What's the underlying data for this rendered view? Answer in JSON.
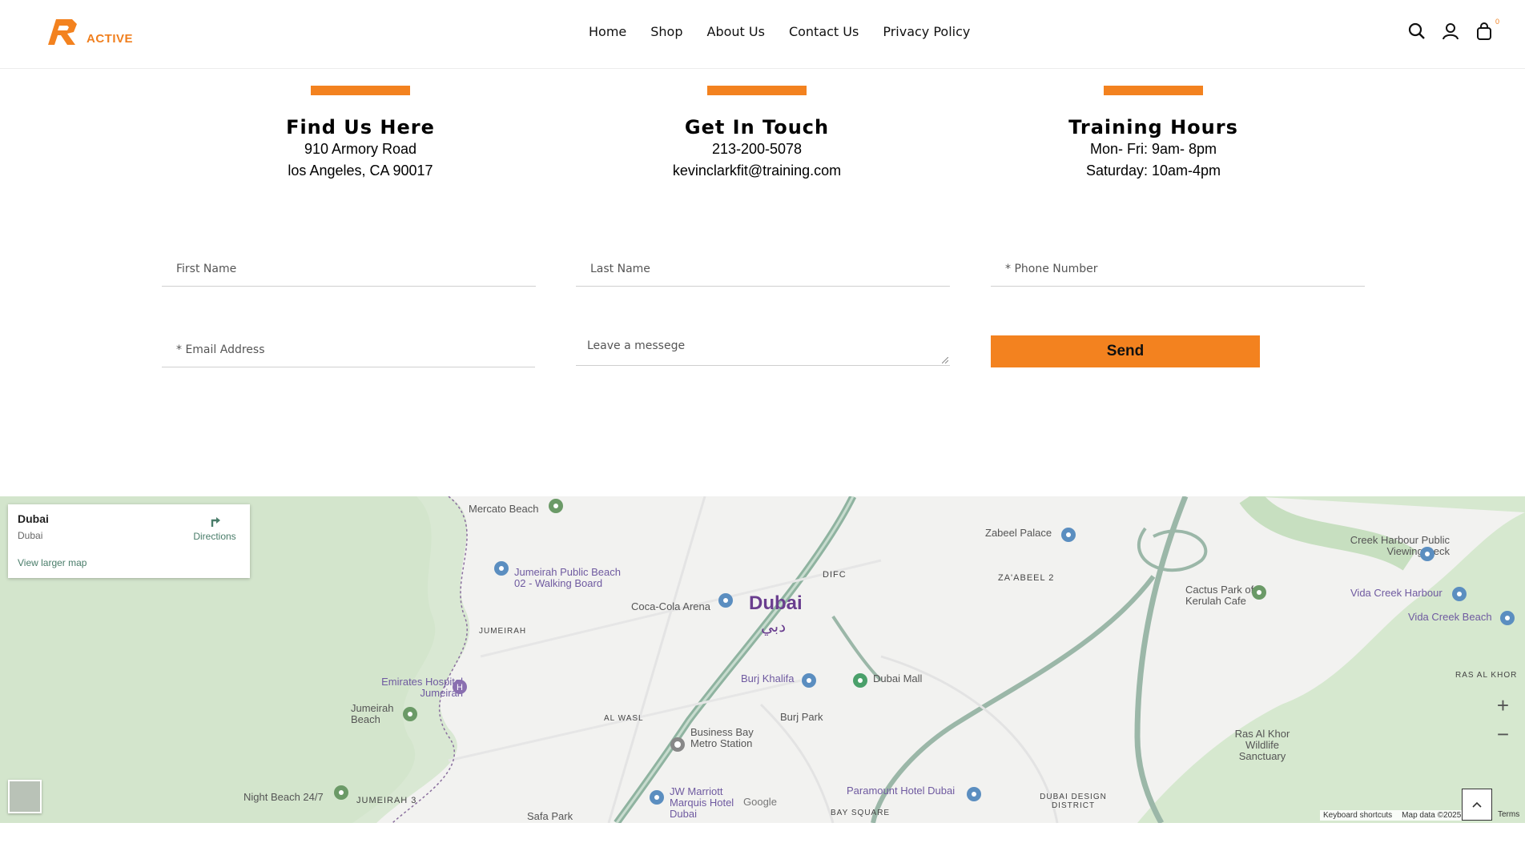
{
  "header": {
    "logo_text": "ACTIVE",
    "nav": [
      "Home",
      "Shop",
      "About Us",
      "Contact Us",
      "Privacy Policy"
    ],
    "icons": [
      "search-icon",
      "user-icon",
      "cart-icon"
    ],
    "cart_count": "0"
  },
  "info": [
    {
      "title": "Find Us Here",
      "lines": [
        "910 Armory Road",
        "los Angeles, CA 90017"
      ]
    },
    {
      "title": "Get In Touch",
      "lines": [
        "213-200-5078",
        "kevinclarkfit@training.com"
      ]
    },
    {
      "title": "Training Hours",
      "lines": [
        "Mon- Fri: 9am- 8pm",
        "Saturday: 10am-4pm"
      ]
    }
  ],
  "form": {
    "first_name": "First Name",
    "last_name": "Last Name",
    "phone": "* Phone Number",
    "email": "* Email Address",
    "message": "Leave a  messege",
    "send": "Send"
  },
  "map": {
    "card": {
      "place": "Dubai",
      "address": "Dubai",
      "directions": "Directions",
      "larger": "View larger map"
    },
    "city": "Dubai",
    "city_ar": "دبي",
    "places": [
      "Mercato Beach",
      "Jumeirah Public Beach 02 - Walking Board",
      "Coca-Cola Arena",
      "DIFC",
      "Zabeel Palace",
      "ZA'ABEEL 2",
      "Creek Harbour Public Viewing Deck",
      "Cactus Park of Kerulah Cafe",
      "Vida Creek Harbour",
      "Vida Creek Beach",
      "JUMEIRAH",
      "Emirates Hospital Jumeirah",
      "Jumeirah Beach",
      "Burj Khalifa",
      "Dubai Mall",
      "AL WASL",
      "Burj Park",
      "Business Bay Metro Station",
      "Ras Al Khor Wildlife Sanctuary",
      "RAS AL KHOR",
      "Night Beach 24/7",
      "JUMEIRAH 3",
      "JW Marriott Marquis Hotel Dubai",
      "Paramount Hotel Dubai",
      "DUBAI DESIGN DISTRICT",
      "BAY SQUARE",
      "Safa Park"
    ],
    "footer": [
      "Keyboard shortcuts",
      "Map data ©2025",
      "Terms"
    ],
    "google": "Google"
  },
  "colors": {
    "accent": "#f3821f",
    "map_bg": "#f2f2f0",
    "park": "#cfe5c8",
    "road": "#9bb7a8"
  }
}
